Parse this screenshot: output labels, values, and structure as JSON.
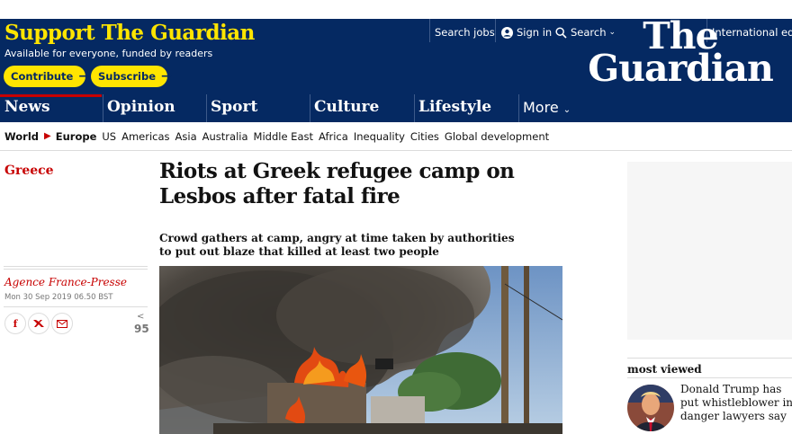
{
  "support": {
    "title": "Support The Guardian",
    "subtitle": "Available for everyone, funded by readers",
    "contribute_label": "Contribute",
    "subscribe_label": "Subscribe"
  },
  "toplinks": {
    "jobs": "Search jobs",
    "signin": "Sign in",
    "search": "Search",
    "edition": "International edit"
  },
  "logo": {
    "line1": "The",
    "line2": "Guardian"
  },
  "nav": [
    {
      "label": "News",
      "accent": "#c70000"
    },
    {
      "label": "Opinion",
      "accent": "#e05e00"
    },
    {
      "label": "Sport",
      "accent": "#0084c6"
    },
    {
      "label": "Culture",
      "accent": "#a1845c"
    },
    {
      "label": "Lifestyle",
      "accent": "#bb3b80"
    },
    {
      "label": "More"
    }
  ],
  "subnav": {
    "world": "World",
    "europe": "Europe",
    "items": [
      "US",
      "Americas",
      "Asia",
      "Australia",
      "Middle East",
      "Africa",
      "Inequality",
      "Cities",
      "Global development"
    ]
  },
  "article": {
    "section": "Greece",
    "headline": "Riots at Greek refugee camp on Lesbos after fatal fire",
    "standfirst": "Crowd gathers at camp, angry at time taken by authorities to put out blaze that killed at least two people",
    "byline": "Agence France-Presse",
    "date": "Mon 30 Sep 2019 06.50 BST",
    "share_count": "95"
  },
  "most_viewed": {
    "title": "most viewed",
    "item1": "Donald Trump has put whistleblower in danger lawyers say"
  },
  "colors": {
    "brand_blue": "#052962",
    "support_yellow": "#ffe500",
    "news_red": "#c70000"
  },
  "icons": {
    "signin": "user-icon",
    "search": "search-icon",
    "facebook": "facebook-icon",
    "twitter": "twitter-icon",
    "email": "email-icon"
  }
}
